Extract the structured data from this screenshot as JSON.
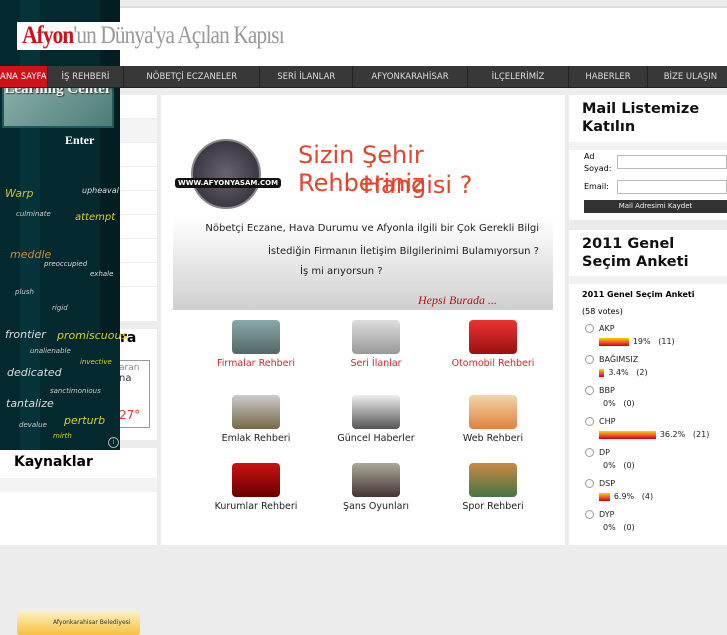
{
  "header": {
    "logo_red": "Afyon",
    "logo_gray": "'un Dünya'ya Açılan Kapısı"
  },
  "nav": [
    "ANA SAYFA",
    "İŞ REHBERİ",
    "NÖBETÇİ ECZANELER",
    "SERİ İLANLAR",
    "AFYONKARAHİSAR",
    "İLÇELERİMİZ",
    "HABERLER",
    "BİZE ULAŞIN"
  ],
  "banner": {
    "site": "WWW.AFYONYASAM.COM",
    "title1": "Sizin Şehir Rehberiniz",
    "title2": "Hangisi ?",
    "line1": "Nöbetçi Eczane, Hava Durumu ve Afyonla ilgili bir Çok Gerekli Bilgi",
    "line2": "İstediğin Firmanın İletişim Bilgilerinimi Bulamıyorsun ?",
    "line3": "İş mi arıyorsun ?",
    "tag": "Hepsi Burada ..."
  },
  "grid": [
    {
      "label": "Firmalar Rehberi",
      "icon": "magnifier-city-icon"
    },
    {
      "label": "Seri İlanlar",
      "icon": "newspaper-reader-icon"
    },
    {
      "label": "Otomobil Rehberi",
      "icon": "car-icon"
    },
    {
      "label": "Emlak Rehberi",
      "icon": "house-icon"
    },
    {
      "label": "Güncel Haberler",
      "icon": "news-icon"
    },
    {
      "label": "Web Rehberi",
      "icon": "www-icon"
    },
    {
      "label": "Kurumlar Rehberi",
      "icon": "turkish-flag-icon"
    },
    {
      "label": "Şans Oyunları",
      "icon": "lottery-icon"
    },
    {
      "label": "Spor Rehberi",
      "icon": "sports-icon"
    }
  ],
  "mail": {
    "title": "Mail Listemize Katılın",
    "name_label": "Ad Soyad:",
    "email_label": "Email:",
    "button": "Mail Adresimi Kaydet"
  },
  "poll": {
    "title": "2011 Genel Seçim Anketi",
    "subtitle": "2011 Genel Seçim Anketi",
    "votes": "(58 votes)",
    "items": [
      {
        "name": "AKP",
        "pct": "19%",
        "count": "(11)",
        "value": 19
      },
      {
        "name": "BAĞIMSIZ",
        "pct": "3.4%",
        "count": "(2)",
        "value": 3.4
      },
      {
        "name": "BBP",
        "pct": "0%",
        "count": "(0)",
        "value": 0
      },
      {
        "name": "CHP",
        "pct": "36.2%",
        "count": "(21)",
        "value": 36.2
      },
      {
        "name": "DP",
        "pct": "0%",
        "count": "(0)",
        "value": 0
      },
      {
        "name": "DSP",
        "pct": "6.9%",
        "count": "(4)",
        "value": 6.9
      },
      {
        "name": "DYP",
        "pct": "0%",
        "count": "(0)",
        "value": 0
      }
    ]
  },
  "left": {
    "weather_title_frag": "ra",
    "weather_frag1": "aran",
    "weather_frag2": "na",
    "temp": "27°",
    "kaynaklar": "Kaynaklar",
    "belediye": "Afyonkarahisar Belediyesi"
  },
  "ad": {
    "title": "Learning Center",
    "enter": "Enter",
    "words": [
      "Warp",
      "upheaval",
      "culminate",
      "attempt",
      "meddle",
      "preoccupied",
      "exhale",
      "plush",
      "rigid",
      "frontier",
      "promiscuous",
      "unalienable",
      "invective",
      "dedicated",
      "sanctimonious",
      "tantalize",
      "devalue",
      "perturb",
      "mirth"
    ]
  }
}
